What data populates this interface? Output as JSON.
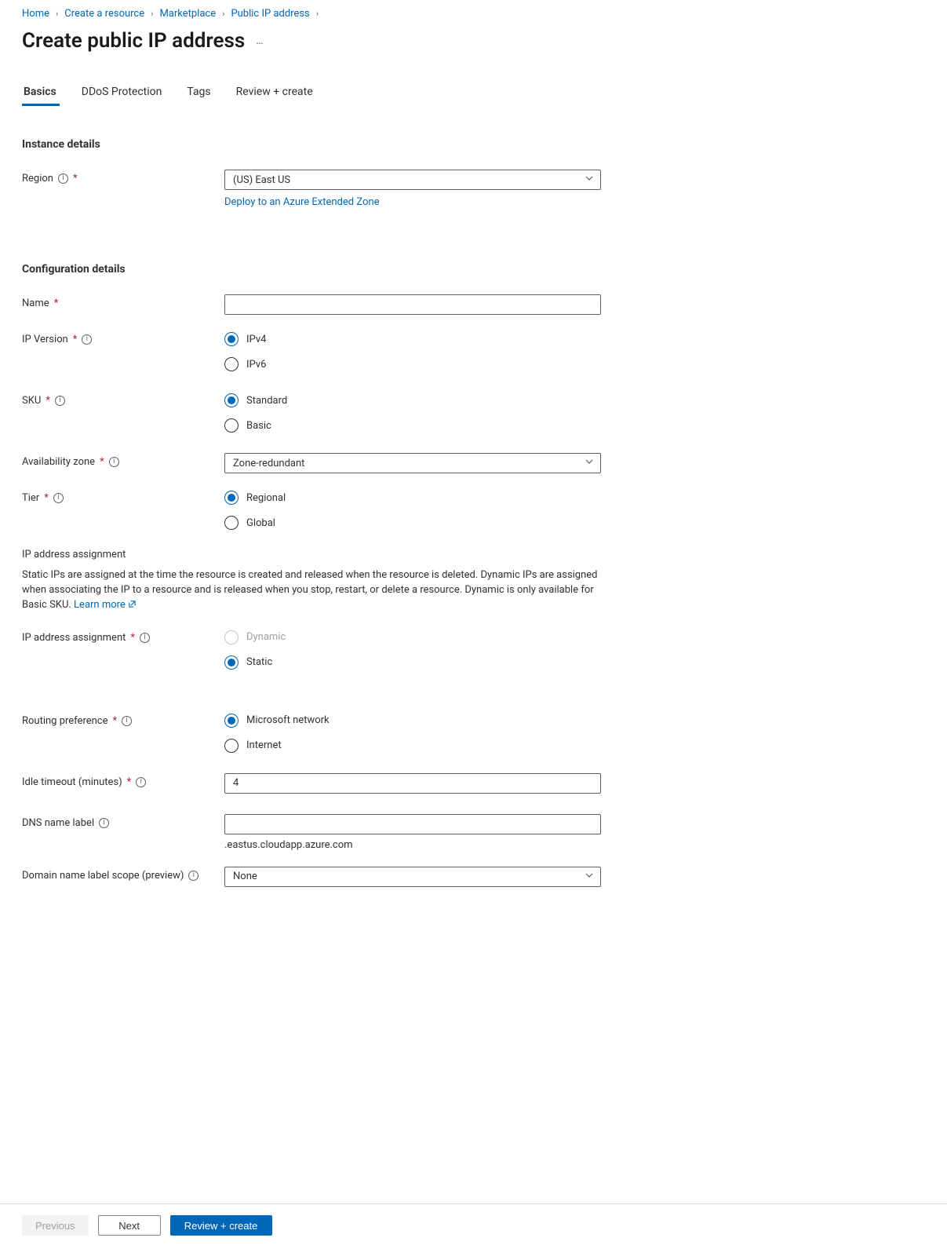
{
  "breadcrumb": {
    "items": [
      "Home",
      "Create a resource",
      "Marketplace",
      "Public IP address"
    ]
  },
  "page": {
    "title": "Create public IP address"
  },
  "tabs": {
    "items": [
      {
        "label": "Basics",
        "active": true
      },
      {
        "label": "DDoS Protection",
        "active": false
      },
      {
        "label": "Tags",
        "active": false
      },
      {
        "label": "Review + create",
        "active": false
      }
    ]
  },
  "sections": {
    "instance": {
      "heading": "Instance details",
      "region": {
        "label": "Region",
        "selected": "(US) East US",
        "helper_link": "Deploy to an Azure Extended Zone"
      }
    },
    "config": {
      "heading": "Configuration details",
      "name": {
        "label": "Name",
        "value": ""
      },
      "ip_version": {
        "label": "IP Version",
        "options": [
          {
            "label": "IPv4",
            "checked": true
          },
          {
            "label": "IPv6",
            "checked": false
          }
        ]
      },
      "sku": {
        "label": "SKU",
        "options": [
          {
            "label": "Standard",
            "checked": true
          },
          {
            "label": "Basic",
            "checked": false
          }
        ]
      },
      "availability_zone": {
        "label": "Availability zone",
        "selected": "Zone-redundant"
      },
      "tier": {
        "label": "Tier",
        "options": [
          {
            "label": "Regional",
            "checked": true
          },
          {
            "label": "Global",
            "checked": false
          }
        ]
      },
      "assignment": {
        "sub_heading": "IP address assignment",
        "help_text": "Static IPs are assigned at the time the resource is created and released when the resource is deleted. Dynamic IPs are assigned when associating the IP to a resource and is released when you stop, restart, or delete a resource. Dynamic is only available for Basic SKU.",
        "learn_more": "Learn more",
        "label": "IP address assignment",
        "options": [
          {
            "label": "Dynamic",
            "checked": false,
            "disabled": true
          },
          {
            "label": "Static",
            "checked": true,
            "disabled": false
          }
        ]
      },
      "routing_preference": {
        "label": "Routing preference",
        "options": [
          {
            "label": "Microsoft network",
            "checked": true
          },
          {
            "label": "Internet",
            "checked": false
          }
        ]
      },
      "idle_timeout": {
        "label": "Idle timeout (minutes)",
        "value": "4"
      },
      "dns_label": {
        "label": "DNS name label",
        "value": "",
        "suffix": ".eastus.cloudapp.azure.com"
      },
      "domain_scope": {
        "label": "Domain name label scope (preview)",
        "selected": "None"
      }
    }
  },
  "footer": {
    "previous": "Previous",
    "next": "Next",
    "review": "Review + create"
  }
}
